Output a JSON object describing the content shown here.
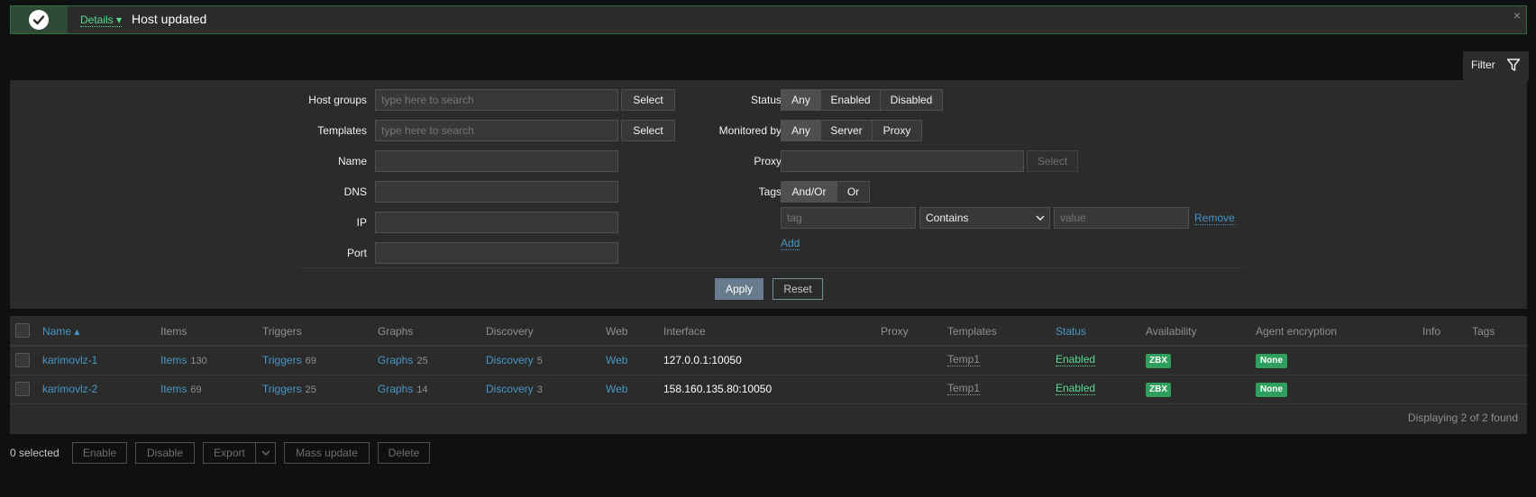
{
  "message": {
    "details_label": "Details ▾",
    "text": "Host updated",
    "close": "×"
  },
  "filter_tab": {
    "label": "Filter",
    "icon": "funnel-icon"
  },
  "filter": {
    "host_groups": {
      "label": "Host groups",
      "placeholder": "type here to search",
      "button": "Select"
    },
    "templates": {
      "label": "Templates",
      "placeholder": "type here to search",
      "button": "Select"
    },
    "name": {
      "label": "Name",
      "value": ""
    },
    "dns": {
      "label": "DNS",
      "value": ""
    },
    "ip": {
      "label": "IP",
      "value": ""
    },
    "port": {
      "label": "Port",
      "value": ""
    },
    "status": {
      "label": "Status",
      "options": [
        "Any",
        "Enabled",
        "Disabled"
      ],
      "selected": "Any"
    },
    "monitored_by": {
      "label": "Monitored by",
      "options": [
        "Any",
        "Server",
        "Proxy"
      ],
      "selected": "Any"
    },
    "proxy": {
      "label": "Proxy",
      "value": "",
      "button": "Select"
    },
    "tags": {
      "label": "Tags",
      "options": [
        "And/Or",
        "Or"
      ],
      "selected": "And/Or",
      "tag_placeholder": "tag",
      "operator": "Contains",
      "value_placeholder": "value",
      "remove": "Remove",
      "add": "Add"
    },
    "apply": "Apply",
    "reset": "Reset"
  },
  "table": {
    "columns": [
      "Name ▴",
      "Items",
      "Triggers",
      "Graphs",
      "Discovery",
      "Web",
      "Interface",
      "Proxy",
      "Templates",
      "Status",
      "Availability",
      "Agent encryption",
      "Info",
      "Tags"
    ],
    "rows": [
      {
        "name": "karimovlz-1",
        "items": "Items",
        "items_count": "130",
        "triggers": "Triggers",
        "triggers_count": "69",
        "graphs": "Graphs",
        "graphs_count": "25",
        "discovery": "Discovery",
        "discovery_count": "5",
        "web": "Web",
        "interface": "127.0.0.1:10050",
        "templates": "Temp1",
        "status": "Enabled",
        "availability": "ZBX",
        "encryption": "None"
      },
      {
        "name": "karimovlz-2",
        "items": "Items",
        "items_count": "69",
        "triggers": "Triggers",
        "triggers_count": "25",
        "graphs": "Graphs",
        "graphs_count": "14",
        "discovery": "Discovery",
        "discovery_count": "3",
        "web": "Web",
        "interface": "158.160.135.80:10050",
        "templates": "Temp1",
        "status": "Enabled",
        "availability": "ZBX",
        "encryption": "None"
      }
    ],
    "footer": "Displaying 2 of 2 found"
  },
  "actions": {
    "selected": "0 selected",
    "enable": "Enable",
    "disable": "Disable",
    "export": "Export",
    "export_dropdown": "∨",
    "mass_update": "Mass update",
    "delete": "Delete"
  },
  "colors": {
    "success": "#59db8f",
    "link": "#4796c4",
    "badge_green": "#2f9f5e",
    "apply": "#687b8d"
  }
}
